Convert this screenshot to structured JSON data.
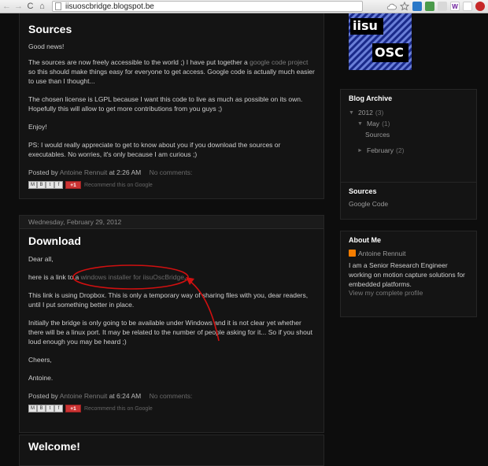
{
  "browser": {
    "url": "iisuoscbridge.blogspot.be",
    "back_glyph": "←",
    "forward_glyph": "→",
    "reload_glyph": "C",
    "home_glyph": "⌂",
    "ext_w_label": "W"
  },
  "posts": [
    {
      "date": "",
      "title": "Sources",
      "para1": "Good news!",
      "para2_a": "The sources are now freely accessible to the world ;) I have put together a ",
      "para2_link": "google code project",
      "para2_b": " so this should make things easy for everyone to get access. Google code is actually much easier to use than I thought...",
      "para3": "The chosen license is LGPL because I want this code to live as much as possible on its own. Hopefully this will allow to get more contributions from you guys ;)",
      "para4": "Enjoy!",
      "para5": "PS: I would really appreciate to get to know about you if you download the sources or executables. No worries, it's only because I am curious ;)",
      "posted_by": "Posted by ",
      "author": "Antoine Rennuit",
      "at": " at ",
      "time": "2:26 AM",
      "comments": "No comments:",
      "plus_label": "+1",
      "recommend": "Recommend this on Google"
    },
    {
      "date": "Wednesday, February 29, 2012",
      "title": "Download",
      "para1": "Dear all,",
      "para2_a": "here is a link to a ",
      "para2_link": "windows installer for iisuOscBridge",
      "para2_b": ".",
      "para3": "This link is using Dropbox. This is only a temporary way of sharing files with you, dear readers, until I put something better in place.",
      "para4": "Initially the bridge is only going to be available under Windows and it is not clear yet whether there will be a linux port. It may be related to the number of people asking for it... So if you shout loud enough you may be heard ;)",
      "para5": "Cheers,",
      "para6": "Antoine.",
      "posted_by": "Posted by ",
      "author": "Antoine Rennuit",
      "at": " at ",
      "time": "6:24 AM",
      "comments": "No comments:",
      "plus_label": "+1",
      "recommend": "Recommend this on Google"
    },
    {
      "title": "Welcome!"
    }
  ],
  "share_buttons": [
    "M",
    "B",
    "t",
    "f"
  ],
  "sidebar": {
    "logo_top": "iisu",
    "logo_bottom": "OSC",
    "archive": {
      "title": "Blog Archive",
      "year": "2012",
      "year_count": "(3)",
      "month1": "May",
      "month1_count": "(1)",
      "post1": "Sources",
      "month2": "February",
      "month2_count": "(2)"
    },
    "sources": {
      "title": "Sources",
      "link": "Google Code"
    },
    "about": {
      "title": "About Me",
      "name": "Antoine Rennuit",
      "bio": "I am a Senior Research Engineer working on motion capture solutions for embedded platforms.",
      "profile_link": "View my complete profile"
    }
  }
}
